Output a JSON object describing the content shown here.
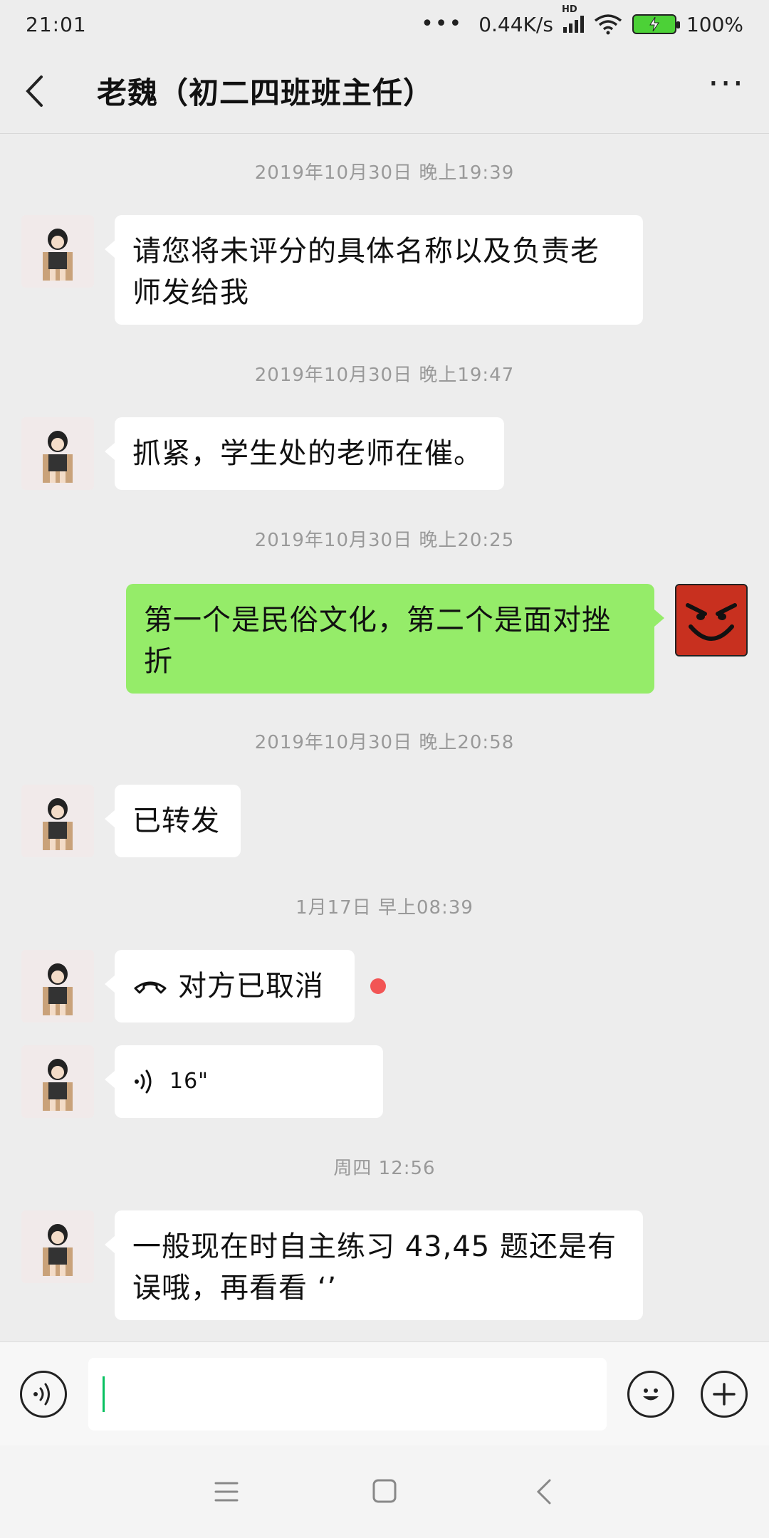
{
  "status_bar": {
    "time": "21:01",
    "net_speed": "0.44K/s",
    "signal_label": "HD",
    "battery": "100%"
  },
  "header": {
    "title": "老魏（初二四班班主任）"
  },
  "messages": [
    {
      "time": "2019年10月30日 晚上19:39",
      "side": "left",
      "text": "请您将未评分的具体名称以及负责老师发给我"
    },
    {
      "time": "2019年10月30日 晚上19:47",
      "side": "left",
      "text": "抓紧，学生处的老师在催。"
    },
    {
      "time": "2019年10月30日 晚上20:25",
      "side": "right",
      "text": "第一个是民俗文化，第二个是面对挫折"
    },
    {
      "time": "2019年10月30日 晚上20:58",
      "side": "left",
      "text": "已转发"
    },
    {
      "time": "1月17日 早上08:39",
      "side": "left",
      "text": "对方已取消",
      "kind": "call"
    },
    {
      "side": "left",
      "text": "16\"",
      "kind": "voice"
    },
    {
      "time": "周四 12:56",
      "side": "left",
      "text": "一般现在时自主练习 43,45 题还是有误哦，再看看 ‘’"
    }
  ],
  "input": {
    "value": "",
    "placeholder": ""
  },
  "colors": {
    "self_bubble": "#95ec69",
    "unread": "#f25555",
    "cursor": "#07c160"
  },
  "icons": {
    "back": "chevron-left-icon",
    "more": "more-icon",
    "voice": "voice-icon",
    "emoji": "emoji-icon",
    "add": "add-icon"
  }
}
